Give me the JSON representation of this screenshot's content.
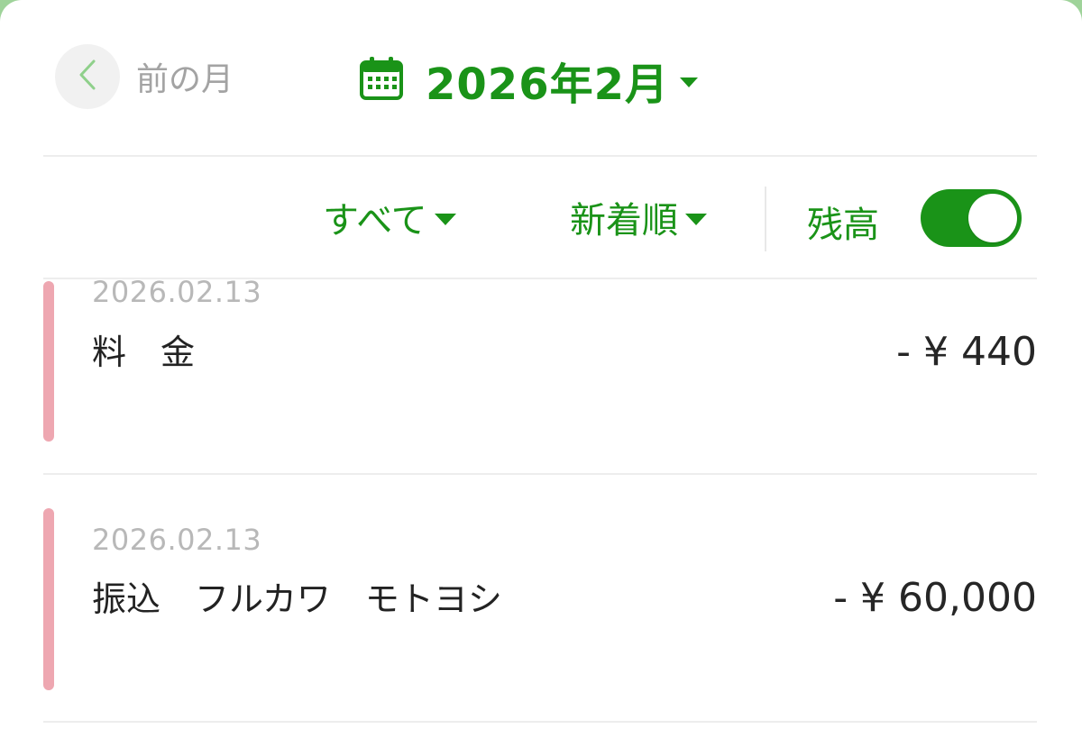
{
  "header": {
    "prev_label": "前の月",
    "month_title": "2026年2月"
  },
  "filters": {
    "type_label": "すべて",
    "sort_label": "新着順",
    "balance_label": "残高",
    "balance_toggle_on": true
  },
  "transactions": [
    {
      "date": "2026.02.13",
      "description": "料　金",
      "amount": "- ¥ 440",
      "type": "withdrawal"
    },
    {
      "date": "2026.02.13",
      "description": "振込　フルカワ　モトヨシ",
      "amount": "- ¥ 60,000",
      "type": "withdrawal"
    }
  ],
  "colors": {
    "accent": "#1a9318",
    "withdrawal_bar": "#eea7b1"
  },
  "icons": {
    "back": "chevron-left-icon",
    "calendar": "calendar-icon",
    "dropdown": "caret-down-icon"
  }
}
